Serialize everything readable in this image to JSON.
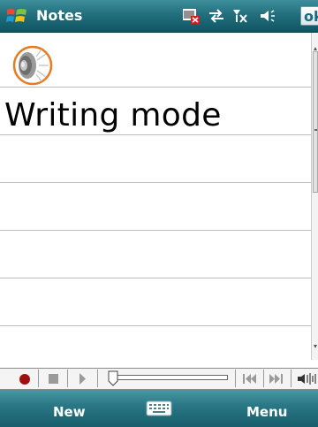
{
  "titlebar": {
    "app_title": "Notes",
    "ok_label": "ok",
    "icons": [
      "windows-start-icon",
      "sim-card-missing-icon",
      "connectivity-icon",
      "signal-off-icon",
      "speaker-icon"
    ]
  },
  "note": {
    "voice_icon": "speaker-voice-note-icon",
    "text": "Writing mode"
  },
  "recorder": {
    "controls": [
      "record",
      "stop",
      "play",
      "slider",
      "previous",
      "next",
      "volume"
    ],
    "colors": {
      "record": "#a01010"
    }
  },
  "softkeys": {
    "left_label": "New",
    "right_label": "Menu",
    "center_icon": "keyboard-icon"
  },
  "colors": {
    "bar_top": "#3e8e9b",
    "bar_bottom": "#0f5563",
    "ok_text": "#1b6a84",
    "rule": "#bcbcbc",
    "voice_ring": "#e87a22"
  }
}
